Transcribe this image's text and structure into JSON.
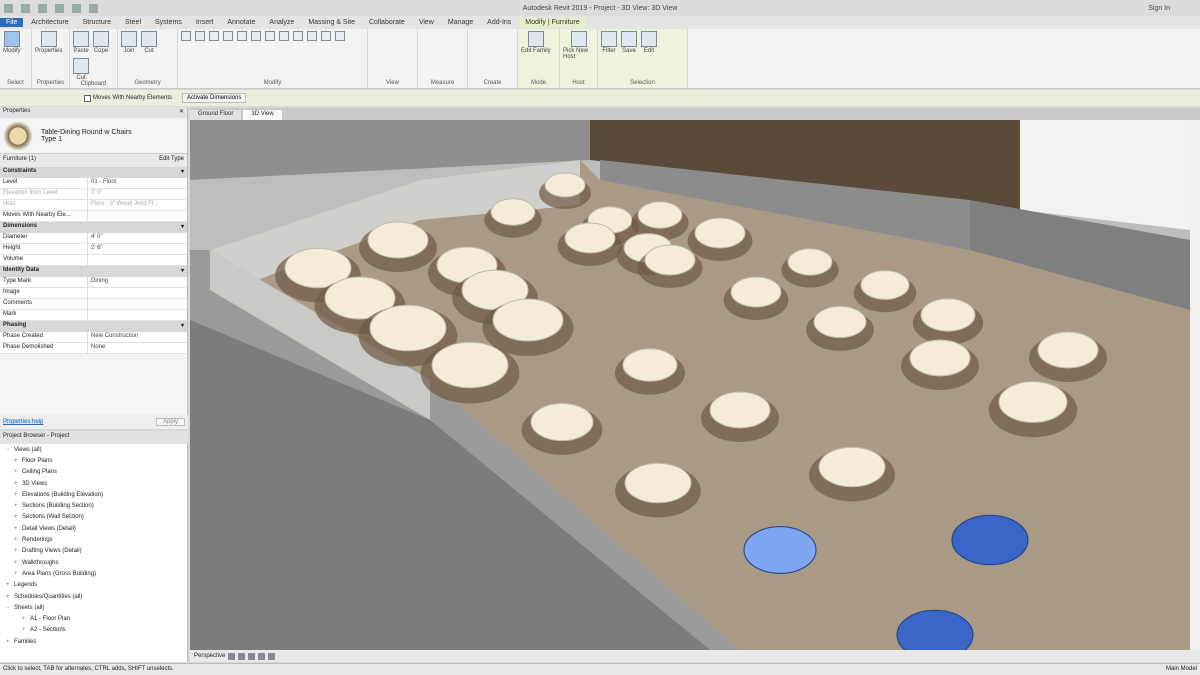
{
  "app": {
    "title": "Autodesk Revit 2019 - Project - 3D View: 3D View",
    "user": "Sign In"
  },
  "ribbon_tabs": [
    "File",
    "Architecture",
    "Structure",
    "Steel",
    "Systems",
    "Insert",
    "Annotate",
    "Analyze",
    "Massing & Site",
    "Collaborate",
    "View",
    "Manage",
    "Add-Ins",
    "Modify | Furniture"
  ],
  "ribbon_panels": [
    {
      "title": "Select",
      "buttons": [
        "Modify"
      ]
    },
    {
      "title": "Properties",
      "buttons": [
        "Properties"
      ]
    },
    {
      "title": "Clipboard",
      "buttons": [
        "Paste",
        "Cope",
        "Cut"
      ]
    },
    {
      "title": "Geometry",
      "buttons": [
        "Join",
        "Cut"
      ]
    },
    {
      "title": "Modify",
      "buttons": [
        "Align",
        "Offset",
        "Mirror",
        "Move",
        "Copy",
        "Rotate",
        "Trim",
        "Split",
        "Array",
        "Scale",
        "Pin",
        "Delete"
      ]
    },
    {
      "title": "View",
      "buttons": []
    },
    {
      "title": "Measure",
      "buttons": []
    },
    {
      "title": "Create",
      "buttons": []
    },
    {
      "title": "Mode",
      "buttons": [
        "Edit Family"
      ]
    },
    {
      "title": "Host",
      "buttons": [
        "Pick New Host"
      ]
    },
    {
      "title": "Selection",
      "buttons": [
        "Filter",
        "Save",
        "Edit"
      ]
    }
  ],
  "options_bar": {
    "moves_with_nearby": "Moves With Nearby Elements",
    "activate_dimensions": "Activate Dimensions"
  },
  "view_tabs": [
    "Ground Floor",
    "3D View"
  ],
  "properties": {
    "header": "Properties",
    "family": "Table-Dining Round w Chairs",
    "type": "Type 1",
    "filter": "Furniture (1)",
    "edit_type": "Edit Type",
    "groups": [
      {
        "name": "Constraints",
        "rows": [
          [
            "Level",
            "01 - Floor"
          ],
          [
            "Elevation from Level",
            "0' 0\""
          ],
          [
            "Host",
            "Floor : 8\" Wood Joist Fl..."
          ],
          [
            "Moves With Nearby Ele...",
            ""
          ]
        ]
      },
      {
        "name": "Dimensions",
        "rows": [
          [
            "Diameter",
            "4' 0\""
          ],
          [
            "Height",
            "2' 6\""
          ],
          [
            "Volume",
            ""
          ]
        ]
      },
      {
        "name": "Identity Data",
        "rows": [
          [
            "Type Mark",
            "Dining"
          ],
          [
            "Image",
            ""
          ],
          [
            "Comments",
            ""
          ],
          [
            "Mark",
            ""
          ]
        ]
      },
      {
        "name": "Phasing",
        "rows": [
          [
            "Phase Created",
            "New Construction"
          ],
          [
            "Phase Demolished",
            "None"
          ]
        ]
      }
    ],
    "help_link": "Properties help",
    "apply": "Apply"
  },
  "project_browser": {
    "header": "Project Browser - Project",
    "items": [
      "Views (all)",
      "Floor Plans",
      "Ceiling Plans",
      "3D Views",
      "Elevations (Building Elevation)",
      "Sections (Building Section)",
      "Sections (Wall Section)",
      "Detail Views (Detail)",
      "Renderings",
      "Drafting Views (Detail)",
      "Walkthroughs",
      "Area Plans (Gross Building)",
      "Legends",
      "Schedules/Quantities (all)",
      "Sheets (all)",
      "A1 - Floor Plan",
      "A2 - Sections",
      "Families"
    ]
  },
  "view_control": {
    "mode": "Perspective"
  },
  "status": {
    "message": "Click to select, TAB for alternates, CTRL adds, SHIFT unselects.",
    "right": "Main Model"
  },
  "colors": {
    "accent": "#2a6db5",
    "floor": "#a89a84",
    "table_top": "#f5ecd8",
    "selected": "#3a66c8",
    "context_tab": "#e6efc8"
  }
}
